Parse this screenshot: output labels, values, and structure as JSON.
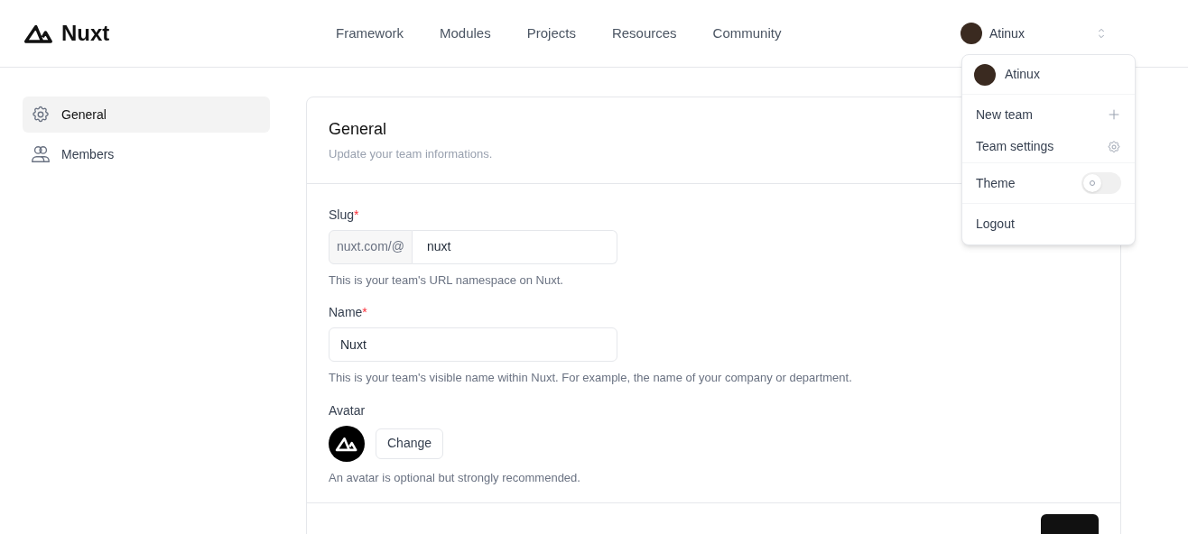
{
  "header": {
    "logo": "Nuxt",
    "nav": [
      {
        "label": "Framework"
      },
      {
        "label": "Modules"
      },
      {
        "label": "Projects"
      },
      {
        "label": "Resources"
      },
      {
        "label": "Community"
      }
    ],
    "user": "Atinux"
  },
  "menu": {
    "user": "Atinux",
    "items": [
      {
        "kind": "add",
        "label": "New team"
      },
      {
        "kind": "settings",
        "label": "Team settings"
      },
      {
        "kind": "toggle",
        "label": "Theme",
        "on": false
      },
      {
        "kind": "plain",
        "label": "Logout"
      }
    ]
  },
  "sidebar": {
    "items": [
      {
        "kind": "general",
        "label": "General",
        "selected": true
      },
      {
        "kind": "members",
        "label": "Members",
        "selected": false
      }
    ]
  },
  "card": {
    "title": "General",
    "subtitle": "Update your team informations.",
    "fields": [
      {
        "kind": "prefixed",
        "label": "Slug",
        "required_mark": "*",
        "prefix": "nuxt.com/@",
        "value": "nuxt",
        "help": "This is your team's URL namespace on Nuxt."
      },
      {
        "kind": "text",
        "label": "Name",
        "required_mark": "*",
        "value": "Nuxt",
        "help": "This is your team's visible name within Nuxt. For example, the name of your company or department."
      },
      {
        "kind": "avatar",
        "label": "Avatar",
        "button": "Change",
        "help": "An avatar is optional but strongly recommended."
      }
    ]
  }
}
